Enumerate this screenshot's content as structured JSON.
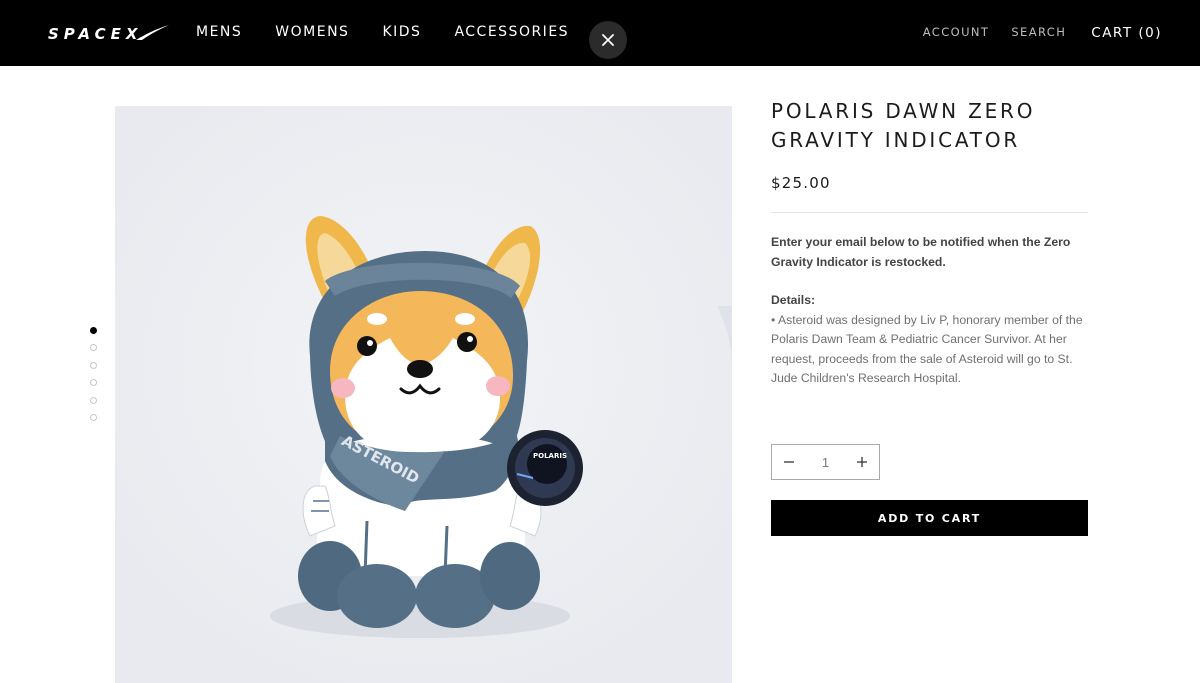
{
  "header": {
    "logo_text": "SPACEX",
    "nav": [
      "MENS",
      "WOMENS",
      "KIDS",
      "ACCESSORIES"
    ],
    "account_label": "ACCOUNT",
    "search_label": "SEARCH",
    "cart_label": "CART (0)",
    "close_icon": "close-icon"
  },
  "gallery": {
    "dot_count": 6,
    "active_index": 0,
    "patch_text": "POLARIS",
    "scarf_text": "ASTEROID"
  },
  "product": {
    "title": "POLARIS DAWN ZERO GRAVITY INDICATOR",
    "price": "$25.00",
    "notify_text": "Enter your email below to be notified when the Zero Gravity Indicator is restocked.",
    "details_label": "Details:",
    "details_text": "• Asteroid was designed by Liv P, honorary member of the Polaris Dawn Team & Pediatric Cancer Survivor. At her request, proceeds from the sale of Asteroid will go to St. Jude Children's Research Hospital.",
    "quantity": "1",
    "add_to_cart_label": "ADD TO CART"
  },
  "colors": {
    "header_bg": "#000000",
    "button_bg": "#000000",
    "image_bg": "#edeff3"
  }
}
